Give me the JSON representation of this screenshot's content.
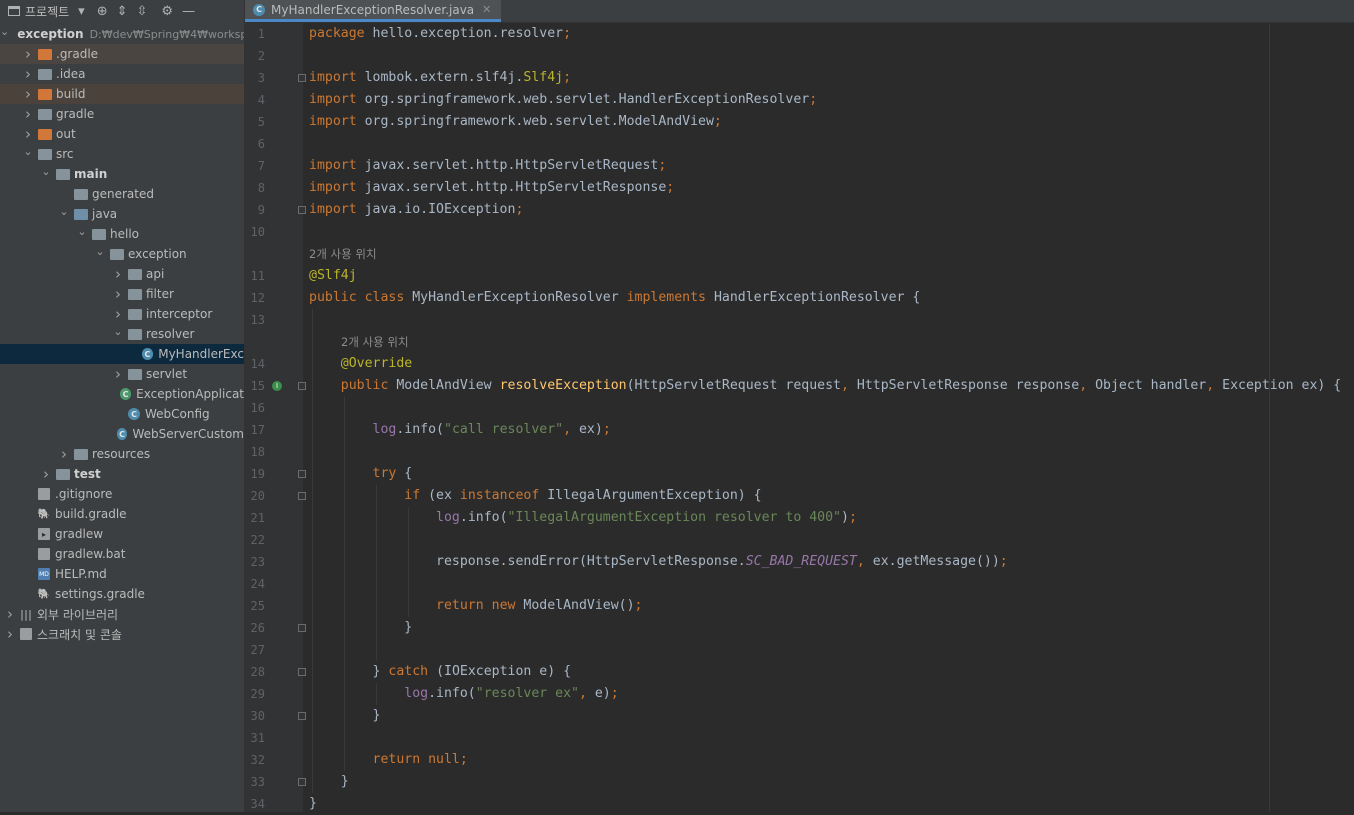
{
  "project_toolbar": {
    "label": "프로젝트"
  },
  "tab": {
    "title": "MyHandlerExceptionResolver.java"
  },
  "tree": [
    {
      "label": "exception",
      "path": "D:₩dev₩Spring₩4₩worksp",
      "level": 0,
      "arrow": "open",
      "icon": "module-folder",
      "bold": true
    },
    {
      "label": ".gradle",
      "level": 1,
      "arrow": "closed",
      "icon": "folder-orange",
      "hl": "hl"
    },
    {
      "label": ".idea",
      "level": 1,
      "arrow": "closed",
      "icon": "folder"
    },
    {
      "label": "build",
      "level": 1,
      "arrow": "closed",
      "icon": "folder-orange",
      "hl": "hl2"
    },
    {
      "label": "gradle",
      "level": 1,
      "arrow": "closed",
      "icon": "folder"
    },
    {
      "label": "out",
      "level": 1,
      "arrow": "closed",
      "icon": "folder-orange"
    },
    {
      "label": "src",
      "level": 1,
      "arrow": "open",
      "icon": "folder"
    },
    {
      "label": "main",
      "level": 2,
      "arrow": "open",
      "icon": "folder-src",
      "bold": true
    },
    {
      "label": "generated",
      "level": 3,
      "arrow": "none",
      "icon": "folder-gen"
    },
    {
      "label": "java",
      "level": 3,
      "arrow": "open",
      "icon": "folder-blue"
    },
    {
      "label": "hello",
      "level": 4,
      "arrow": "open",
      "icon": "package"
    },
    {
      "label": "exception",
      "level": 5,
      "arrow": "open",
      "icon": "package"
    },
    {
      "label": "api",
      "level": 6,
      "arrow": "closed",
      "icon": "package"
    },
    {
      "label": "filter",
      "level": 6,
      "arrow": "closed",
      "icon": "package"
    },
    {
      "label": "interceptor",
      "level": 6,
      "arrow": "closed",
      "icon": "package"
    },
    {
      "label": "resolver",
      "level": 6,
      "arrow": "open",
      "icon": "package"
    },
    {
      "label": "MyHandlerExc",
      "level": 7,
      "arrow": "none",
      "icon": "class",
      "hl": "sel"
    },
    {
      "label": "servlet",
      "level": 6,
      "arrow": "closed",
      "icon": "package"
    },
    {
      "label": "ExceptionApplicat",
      "level": 6,
      "arrow": "none",
      "icon": "class-spring"
    },
    {
      "label": "WebConfig",
      "level": 6,
      "arrow": "none",
      "icon": "class"
    },
    {
      "label": "WebServerCustom",
      "level": 6,
      "arrow": "none",
      "icon": "class"
    },
    {
      "label": "resources",
      "level": 3,
      "arrow": "closed",
      "icon": "folder-res"
    },
    {
      "label": "test",
      "level": 2,
      "arrow": "closed",
      "icon": "folder",
      "bold": true
    },
    {
      "label": ".gitignore",
      "level": 1,
      "arrow": "none",
      "icon": "file-git"
    },
    {
      "label": "build.gradle",
      "level": 1,
      "arrow": "none",
      "icon": "file-gradle"
    },
    {
      "label": "gradlew",
      "level": 1,
      "arrow": "none",
      "icon": "file-exec"
    },
    {
      "label": "gradlew.bat",
      "level": 1,
      "arrow": "none",
      "icon": "file-plain"
    },
    {
      "label": "HELP.md",
      "level": 1,
      "arrow": "none",
      "icon": "file-md"
    },
    {
      "label": "settings.gradle",
      "level": 1,
      "arrow": "none",
      "icon": "file-gradle"
    },
    {
      "label": "외부 라이브러리",
      "level": 0,
      "arrow": "closed",
      "icon": "library"
    },
    {
      "label": "스크래치 및 콘솔",
      "level": 0,
      "arrow": "closed",
      "icon": "scratch"
    }
  ],
  "hints": {
    "class_usages": "2개 사용 위치",
    "method_usages": "2개 사용 위치"
  },
  "line_numbers": [
    "1",
    "2",
    "3",
    "4",
    "5",
    "6",
    "7",
    "8",
    "9",
    "10",
    "11",
    "12",
    "13",
    "14",
    "15",
    "16",
    "17",
    "18",
    "19",
    "20",
    "21",
    "22",
    "23",
    "24",
    "25",
    "26",
    "27",
    "28",
    "29",
    "30",
    "31",
    "32",
    "33",
    "34"
  ],
  "code_lines": [
    [
      [
        "kw",
        "package "
      ],
      [
        "",
        "hello.exception.resolver"
      ],
      [
        "kw",
        ";"
      ]
    ],
    [],
    [
      [
        "kw",
        "import "
      ],
      [
        "",
        "lombok.extern.slf4j."
      ],
      [
        "ann",
        "Slf4j"
      ],
      [
        "kw",
        ";"
      ]
    ],
    [
      [
        "kw",
        "import "
      ],
      [
        "",
        "org.springframework.web.servlet.HandlerExceptionResolver"
      ],
      [
        "kw",
        ";"
      ]
    ],
    [
      [
        "kw",
        "import "
      ],
      [
        "",
        "org.springframework.web.servlet.ModelAndView"
      ],
      [
        "kw",
        ";"
      ]
    ],
    [],
    [
      [
        "kw",
        "import "
      ],
      [
        "",
        "javax.servlet.http.HttpServletRequest"
      ],
      [
        "kw",
        ";"
      ]
    ],
    [
      [
        "kw",
        "import "
      ],
      [
        "",
        "javax.servlet.http.HttpServletResponse"
      ],
      [
        "kw",
        ";"
      ]
    ],
    [
      [
        "kw",
        "import "
      ],
      [
        "",
        "java.io.IOException"
      ],
      [
        "kw",
        ";"
      ]
    ],
    [],
    [
      [
        "ann",
        "@Slf4j"
      ]
    ],
    [
      [
        "kw",
        "public class "
      ],
      [
        "",
        "MyHandlerExceptionResolver "
      ],
      [
        "kw",
        "implements "
      ],
      [
        "",
        "HandlerExceptionResolver {"
      ]
    ],
    [],
    [
      [
        "",
        "    "
      ],
      [
        "ann",
        "@Override"
      ]
    ],
    [
      [
        "",
        "    "
      ],
      [
        "kw",
        "public "
      ],
      [
        "",
        "ModelAndView "
      ],
      [
        "fn",
        "resolveException"
      ],
      [
        "",
        "(HttpServletRequest request"
      ],
      [
        "kw",
        ", "
      ],
      [
        "",
        "HttpServletResponse response"
      ],
      [
        "kw",
        ", "
      ],
      [
        "",
        "Object handler"
      ],
      [
        "kw",
        ", "
      ],
      [
        "",
        "Exception ex) {"
      ]
    ],
    [],
    [
      [
        "",
        "        "
      ],
      [
        "fld",
        "log"
      ],
      [
        "",
        ".info("
      ],
      [
        "str",
        "\"call resolver\""
      ],
      [
        "kw",
        ", "
      ],
      [
        "",
        "ex)"
      ],
      [
        "kw",
        ";"
      ]
    ],
    [],
    [
      [
        "",
        "        "
      ],
      [
        "kw",
        "try "
      ],
      [
        "",
        "{"
      ]
    ],
    [
      [
        "",
        "            "
      ],
      [
        "kw",
        "if "
      ],
      [
        "",
        "(ex "
      ],
      [
        "kw",
        "instanceof "
      ],
      [
        "",
        "IllegalArgumentException) {"
      ]
    ],
    [
      [
        "",
        "                "
      ],
      [
        "fld",
        "log"
      ],
      [
        "",
        ".info("
      ],
      [
        "str",
        "\"IllegalArgumentException resolver to 400\""
      ],
      [
        "",
        ")"
      ],
      [
        "kw",
        ";"
      ]
    ],
    [],
    [
      [
        "",
        "                "
      ],
      [
        "",
        "response.sendError(HttpServletResponse."
      ],
      [
        "sfld",
        "SC_BAD_REQUEST"
      ],
      [
        "kw",
        ", "
      ],
      [
        "",
        "ex.getMessage())"
      ],
      [
        "kw",
        ";"
      ]
    ],
    [],
    [
      [
        "",
        "                "
      ],
      [
        "kw",
        "return new "
      ],
      [
        "",
        "ModelAndView()"
      ],
      [
        "kw",
        ";"
      ]
    ],
    [
      [
        "",
        "            "
      ],
      [
        "",
        "}"
      ]
    ],
    [],
    [
      [
        "",
        "        "
      ],
      [
        "",
        "} "
      ],
      [
        "kw",
        "catch "
      ],
      [
        "",
        "(IOException e) {"
      ]
    ],
    [
      [
        "",
        "            "
      ],
      [
        "fld",
        "log"
      ],
      [
        "",
        ".info("
      ],
      [
        "str",
        "\"resolver ex\""
      ],
      [
        "kw",
        ", "
      ],
      [
        "",
        "e)"
      ],
      [
        "kw",
        ";"
      ]
    ],
    [
      [
        "",
        "        "
      ],
      [
        "",
        "}"
      ]
    ],
    [],
    [
      [
        "",
        "        "
      ],
      [
        "kw",
        "return null;"
      ]
    ],
    [
      [
        "",
        "    "
      ],
      [
        "",
        "}"
      ]
    ],
    [
      [
        "",
        "}"
      ]
    ]
  ]
}
